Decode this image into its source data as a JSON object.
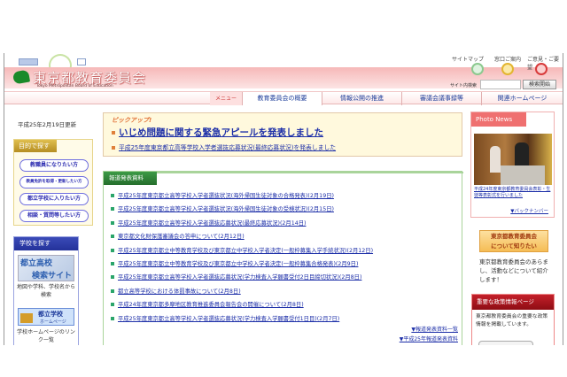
{
  "header": {
    "logo_title": "東京都教育委員会",
    "logo_subtitle": "Tokyo Metropolitan Board of Education",
    "top_links": [
      "サイトマップ",
      "窓口ご案内",
      "ご意見・ご要望"
    ],
    "top_icons": [
      "sitemap-icon",
      "counter-guide-icon",
      "postbox-icon"
    ],
    "search_label": "サイト内検索",
    "search_value": "",
    "search_button": "検索開始"
  },
  "nav": {
    "menu_label": "メニュー",
    "items": [
      "教育委員会の概要",
      "情報公開の推進",
      "審議会議事録等",
      "関連ホームページ"
    ]
  },
  "left": {
    "updated": "平成25年2月19日更新",
    "purpose_title": "目的で探す",
    "purpose_buttons": [
      "教職員になりたい方",
      "教員免許を取得・更新したい方",
      "都立学校に入りたい方",
      "相談・質問等したい方"
    ],
    "school_title": "学校を探す",
    "school_search_banner": [
      "都立高校",
      "検索サイト"
    ],
    "school_search_caption": "地図や学科、学校名から検索",
    "school_hp_banner": [
      "都立学校",
      "ホームページ"
    ],
    "school_hp_caption": "学校ホームページのリンク一覧"
  },
  "pickup": {
    "label": "ピックアップ!",
    "headline": "いじめ問題に関する緊急アピールを発表しました",
    "sub": "平成25年度東京都立高等学校入学者選抜応募状況(最終応募状況)を発表しました"
  },
  "press": {
    "title": "報道発表資料",
    "items": [
      "平成25年度東京都立高等学校入学者選抜状況(海外帰国生徒対象の合格発表)(2月19日)",
      "平成25年度東京都立高等学校入学者選抜状況(海外帰国生徒対象の受検状況)(2月15日)",
      "平成25年度東京都立高等学校入学者選抜応募状況(最終応募状況)(2月14日)",
      "東京都文化財保護審議会の答申について(2月12日)",
      "平成25年度東京都立中等教育学校及び東京都立中学校入学者決定(一般枠募集入学手続状況)(2月12日)",
      "平成25年度東京都立中等教育学校及び東京都立中学校入学者決定(一般枠募集合格発表)(2月9日)",
      "平成25年度東京都立高等学校入学者選抜応募状況(学力検査入学願書受付2日目締切状況)(2月8日)",
      "都立高等学校における体罰事故について(2月8日)",
      "平成24年度東京都多摩地区教育推進委員会報告会の開催について(2月8日)",
      "平成25年度東京都立高等学校入学者選抜応募状況(学力検査入学願書受付1日目)(2月7日)"
    ],
    "more_links": [
      "▼報道発表資料一覧",
      "▼平成25年報道発表資料"
    ]
  },
  "right": {
    "photo_title": "Photo News",
    "photo_caption": "平成24年度東京都教育委員会表彰・生徒等表彰式を行いました",
    "back_number": "▼バックナンバー",
    "about_button": [
      "東京都教育委員会",
      "について知りたい"
    ],
    "about_text": "東京都教育委員会のあらまし、活動などについて紹介します！",
    "policy_title": "重要な政策情報ページ",
    "policy_text": "東京都教育委員会の重要な政策情報を掲載しています。"
  },
  "colors": {
    "band": "#f6b8b8",
    "link": "#1d2fa8",
    "press_green": "#2f8a3a",
    "photo_red": "#e85a5a",
    "school_blue": "#2f3ea8",
    "purpose_gold": "#c9a43a"
  }
}
